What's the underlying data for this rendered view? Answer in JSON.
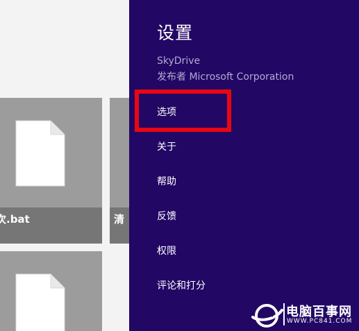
{
  "files": [
    {
      "caption": "次.bat"
    },
    {
      "caption": "清"
    },
    {
      "caption": ""
    }
  ],
  "settings": {
    "title": "设置",
    "app_name": "SkyDrive",
    "publisher": "发布者 Microsoft Corporation",
    "items": [
      {
        "label": "选项"
      },
      {
        "label": "关于"
      },
      {
        "label": "帮助"
      },
      {
        "label": "反馈"
      },
      {
        "label": "权限"
      },
      {
        "label": "评论和打分"
      }
    ],
    "highlight_color": "#e80711",
    "background_color": "#220765"
  },
  "watermark": {
    "text": "电脑百事网",
    "url": "WWW.PC841.COM"
  }
}
